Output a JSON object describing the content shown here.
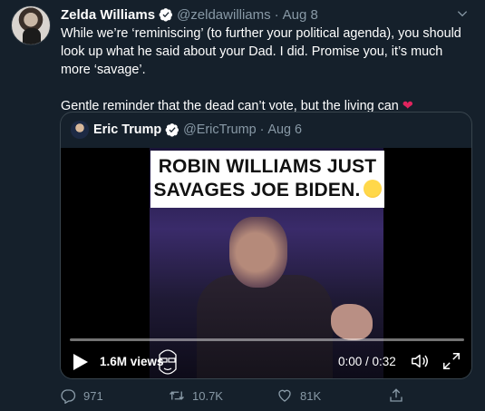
{
  "tweet": {
    "author_name": "Zelda Williams",
    "author_handle": "@zeldawilliams",
    "dot": "·",
    "date": "Aug 8",
    "text_para1": "While we’re ‘reminiscing’ (to further your political agenda), you should look up what he said about your Dad. I did. Promise you, it’s much more ‘savage’.",
    "text_para2": "Gentle reminder that the dead can’t vote, but the living can",
    "heart": "❤",
    "icons": {
      "verified": "verified-badge-icon",
      "caret": "chevron-down-icon"
    }
  },
  "quoted": {
    "author_name": "Eric Trump",
    "author_handle": "@EricTrump",
    "dot": "·",
    "date": "Aug 6",
    "caption_line1": "ROBIN WILLIAMS JUST",
    "caption_line2": "SAVAGES JOE BIDEN.",
    "video": {
      "views": "1.6M views",
      "time": "0:00 / 0:32",
      "progress": 0
    }
  },
  "actions": {
    "replies": "971",
    "retweets": "10.7K",
    "likes": "81K"
  },
  "colors": {
    "background": "#15202b",
    "secondary_text": "#8899a6",
    "accent": "#1da1f2",
    "border": "#38444d",
    "heart": "#e0245e"
  }
}
